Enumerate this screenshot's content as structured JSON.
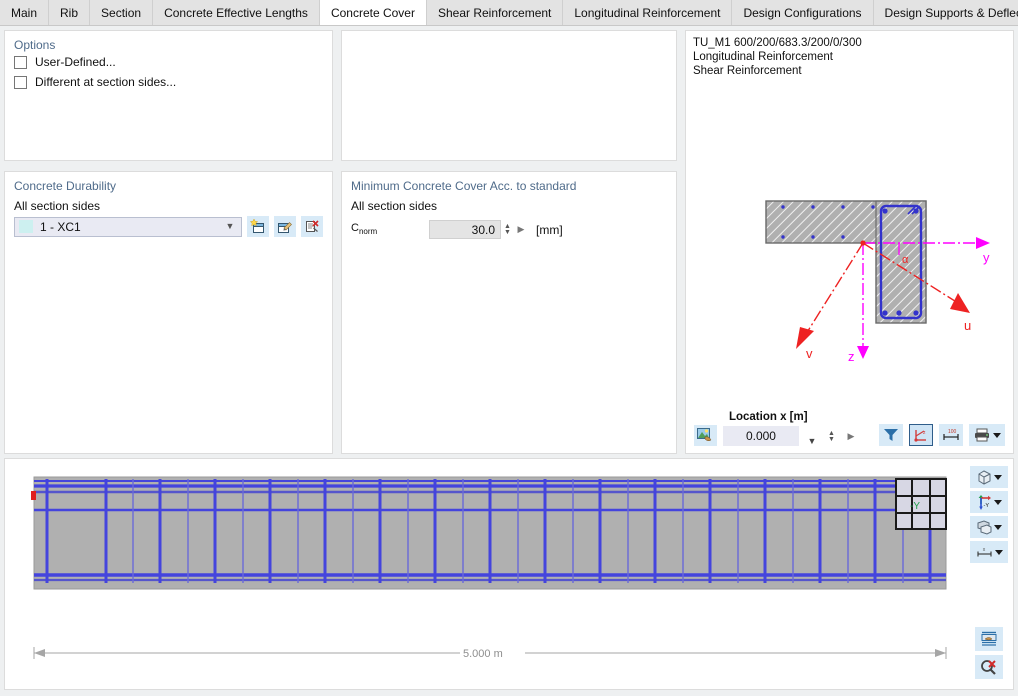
{
  "tabs": [
    {
      "label": "Main",
      "active": false
    },
    {
      "label": "Rib",
      "active": false
    },
    {
      "label": "Section",
      "active": false
    },
    {
      "label": "Concrete Effective Lengths",
      "active": false
    },
    {
      "label": "Concrete Cover",
      "active": true
    },
    {
      "label": "Shear Reinforcement",
      "active": false
    },
    {
      "label": "Longitudinal Reinforcement",
      "active": false
    },
    {
      "label": "Design Configurations",
      "active": false
    },
    {
      "label": "Design Supports & Deflection",
      "active": false
    }
  ],
  "options": {
    "title": "Options",
    "checkboxes": [
      {
        "label": "User-Defined...",
        "checked": false
      },
      {
        "label": "Different at section sides...",
        "checked": false
      }
    ]
  },
  "durability": {
    "title": "Concrete Durability",
    "sides_label": "All section sides",
    "selected": "1 - XC1",
    "swatch_color": "#cdf0f0",
    "buttons": [
      {
        "name": "new-exposure-class-button",
        "icon": "new-icon"
      },
      {
        "name": "edit-exposure-class-button",
        "icon": "edit-icon"
      },
      {
        "name": "delete-exposure-class-button",
        "icon": "delete-icon"
      }
    ]
  },
  "min_cover": {
    "title": "Minimum Concrete Cover Acc. to standard",
    "sides_label": "All section sides",
    "field_name": "C",
    "field_subscript": "norm",
    "value": "30.0",
    "unit": "[mm]"
  },
  "section_viewer": {
    "caption": "TU_M1 600/200/683.3/200/0/300\nLongitudinal Reinforcement\nShear Reinforcement",
    "axes": [
      {
        "name": "y",
        "color": "#ff00ff"
      },
      {
        "name": "z",
        "color": "#ff00ff"
      },
      {
        "name": "u",
        "color": "#ee2222"
      },
      {
        "name": "v",
        "color": "#ee2222"
      },
      {
        "name": "α",
        "color": "#ee2222"
      }
    ],
    "location_label": "Location x [m]",
    "location_value": "0.000",
    "toolbar": [
      {
        "name": "render-image-button",
        "icon": "image-icon"
      },
      {
        "name": "filter-button",
        "icon": "filter-icon"
      },
      {
        "name": "show-axes-button",
        "icon": "axes-icon",
        "selected": true
      },
      {
        "name": "show-dimensions-button",
        "icon": "dimension-icon"
      },
      {
        "name": "print-button",
        "icon": "printer-icon"
      }
    ]
  },
  "beam_view": {
    "dimension_label": "5.000 m",
    "nav_cube_label": "-Y",
    "side_buttons": [
      {
        "name": "view-mode-button",
        "icon": "cube-icon"
      },
      {
        "name": "axis-orientation-button",
        "icon": "axis-icon",
        "label": "-Y"
      },
      {
        "name": "render-style-button",
        "icon": "solid-icon"
      },
      {
        "name": "dimension-style-button",
        "icon": "measure-icon"
      }
    ],
    "corner_buttons": [
      {
        "name": "edit-table-button",
        "icon": "table-edit-icon"
      },
      {
        "name": "reset-zoom-button",
        "icon": "zoom-reset-icon"
      }
    ]
  },
  "colors": {
    "accent": "#4f6b8a",
    "rebar": "#3333cc",
    "concrete": "#b0b0b0",
    "axis_magenta": "#ff00ff",
    "axis_red": "#ee2222",
    "button_bg": "#d8eaf7"
  }
}
